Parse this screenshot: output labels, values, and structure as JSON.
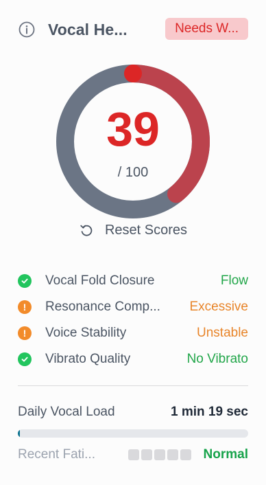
{
  "header": {
    "icon": "info-icon",
    "title": "Vocal He...",
    "badge": "Needs W..."
  },
  "gauge": {
    "score": "39",
    "max_text": "/ 100",
    "score_value": 39,
    "score_max": 100,
    "colors": {
      "track": "#6b7585",
      "fill": "#bb434d",
      "start_marker": "#dc2626"
    }
  },
  "reset": {
    "icon": "reset-icon",
    "label": "Reset Scores"
  },
  "metrics": [
    {
      "label": "Vocal Fold Closure",
      "value": "Flow",
      "status": "ok",
      "color": "#22a64a"
    },
    {
      "label": "Resonance Comp...",
      "value": "Excessive",
      "status": "warn",
      "color": "#e8852a"
    },
    {
      "label": "Voice Stability",
      "value": "Unstable",
      "status": "warn",
      "color": "#e8852a"
    },
    {
      "label": "Vibrato Quality",
      "value": "No Vibrato",
      "status": "ok",
      "color": "#22a64a"
    }
  ],
  "load": {
    "label": "Daily Vocal Load",
    "value": "1 min 19 sec",
    "progress_fraction": 0.01
  },
  "fatigue": {
    "label": "Recent Fati...",
    "status": "Normal",
    "levels_filled": 0,
    "levels_total": 5
  }
}
